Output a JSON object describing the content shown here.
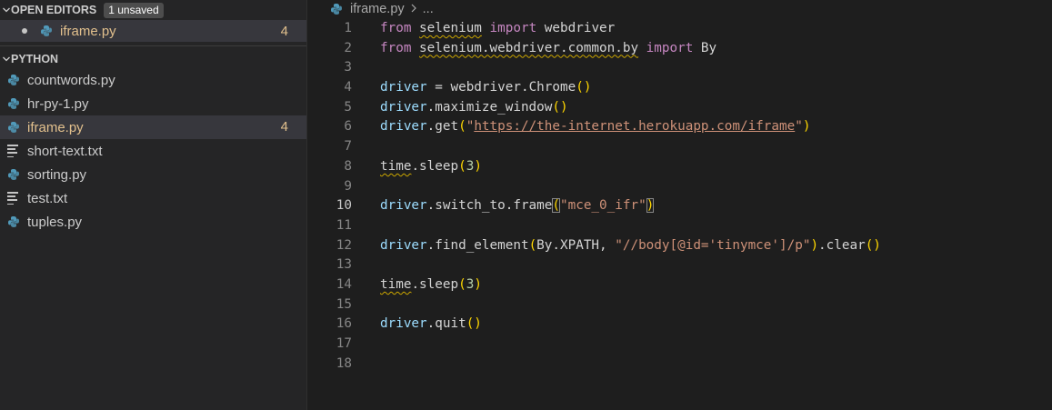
{
  "sidebar": {
    "open_editors": {
      "title": "OPEN EDITORS",
      "badge": "1 unsaved",
      "items": [
        {
          "name": "iframe.py",
          "problems": "4"
        }
      ]
    },
    "folder": {
      "title": "PYTHON",
      "files": [
        {
          "name": "countwords.py",
          "icon": "python-icon"
        },
        {
          "name": "hr-py-1.py",
          "icon": "python-icon"
        },
        {
          "name": "iframe.py",
          "icon": "python-icon",
          "problems": "4"
        },
        {
          "name": "short-text.txt",
          "icon": "text-file-icon"
        },
        {
          "name": "sorting.py",
          "icon": "python-icon"
        },
        {
          "name": "test.txt",
          "icon": "text-file-icon"
        },
        {
          "name": "tuples.py",
          "icon": "python-icon"
        }
      ]
    }
  },
  "editor": {
    "breadcrumb": {
      "file": "iframe.py",
      "separator": ">",
      "rest": "..."
    },
    "active_line": "10",
    "lines": [
      {
        "n": "1",
        "t": [
          [
            "kw",
            "from"
          ],
          [
            "plain",
            " "
          ],
          [
            "sq plain",
            "selenium"
          ],
          [
            "plain",
            " "
          ],
          [
            "kw",
            "import"
          ],
          [
            "plain",
            " webdriver"
          ]
        ]
      },
      {
        "n": "2",
        "t": [
          [
            "kw",
            "from"
          ],
          [
            "plain",
            " "
          ],
          [
            "sq plain",
            "selenium.webdriver.common.by"
          ],
          [
            "plain",
            " "
          ],
          [
            "kw",
            "import"
          ],
          [
            "plain",
            " By"
          ]
        ]
      },
      {
        "n": "3",
        "t": []
      },
      {
        "n": "4",
        "t": [
          [
            "var",
            "driver"
          ],
          [
            "plain",
            " = webdriver."
          ],
          [
            "plain",
            "Chrome"
          ],
          [
            "br",
            "()"
          ]
        ]
      },
      {
        "n": "5",
        "t": [
          [
            "var",
            "driver"
          ],
          [
            "plain",
            ".maximize_window"
          ],
          [
            "br",
            "()"
          ]
        ]
      },
      {
        "n": "6",
        "t": [
          [
            "var",
            "driver"
          ],
          [
            "plain",
            ".get"
          ],
          [
            "br",
            "("
          ],
          [
            "str",
            "\""
          ],
          [
            "str lnk",
            "https://the-internet.herokuapp.com/iframe"
          ],
          [
            "str",
            "\""
          ],
          [
            "br",
            ")"
          ]
        ]
      },
      {
        "n": "7",
        "t": []
      },
      {
        "n": "8",
        "t": [
          [
            "sq plain",
            "time"
          ],
          [
            "plain",
            ".sleep"
          ],
          [
            "br",
            "("
          ],
          [
            "num",
            "3"
          ],
          [
            "br",
            ")"
          ]
        ]
      },
      {
        "n": "9",
        "t": []
      },
      {
        "n": "10",
        "t": [
          [
            "var",
            "driver"
          ],
          [
            "plain",
            ".switch_to.frame"
          ],
          [
            "br br-box",
            "("
          ],
          [
            "str",
            "\"mce_0_ifr\""
          ],
          [
            "br br-box",
            ")"
          ]
        ]
      },
      {
        "n": "11",
        "t": []
      },
      {
        "n": "12",
        "t": [
          [
            "var",
            "driver"
          ],
          [
            "plain",
            ".find_element"
          ],
          [
            "br",
            "("
          ],
          [
            "plain",
            "By.XPATH, "
          ],
          [
            "str",
            "\"//body[@id='tinymce']/p\""
          ],
          [
            "br",
            ")"
          ],
          [
            "plain",
            ".clear"
          ],
          [
            "br",
            "()"
          ]
        ]
      },
      {
        "n": "13",
        "t": []
      },
      {
        "n": "14",
        "t": [
          [
            "sq plain",
            "time"
          ],
          [
            "plain",
            ".sleep"
          ],
          [
            "br",
            "("
          ],
          [
            "num",
            "3"
          ],
          [
            "br",
            ")"
          ]
        ]
      },
      {
        "n": "15",
        "t": []
      },
      {
        "n": "16",
        "t": [
          [
            "var",
            "driver"
          ],
          [
            "plain",
            ".quit"
          ],
          [
            "br",
            "()"
          ]
        ]
      },
      {
        "n": "17",
        "t": []
      },
      {
        "n": "18",
        "t": []
      }
    ]
  },
  "colors": {
    "sidebar_bg": "#252526",
    "editor_bg": "#1e1e1e",
    "modified": "#e2c08d",
    "keyword": "#c586c0",
    "variable": "#9cdcfe",
    "string": "#ce9178",
    "number": "#b5cea8",
    "bracket": "#ffd700"
  }
}
